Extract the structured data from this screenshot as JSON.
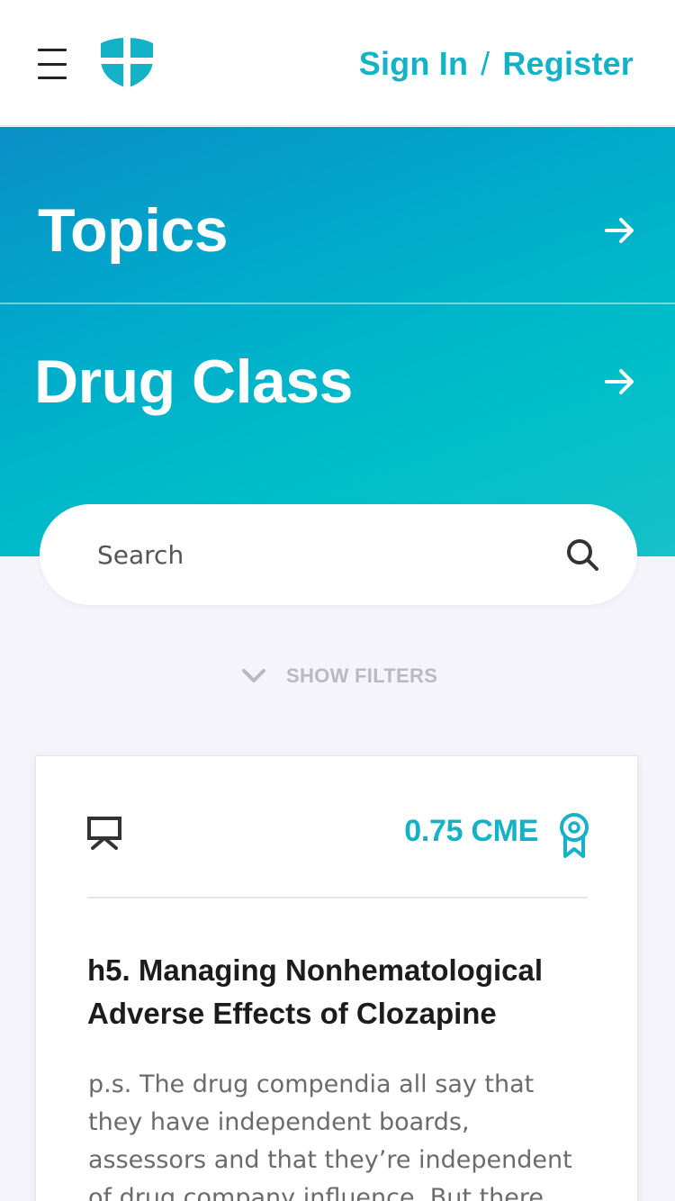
{
  "header": {
    "menu_icon": "hamburger-menu-icon",
    "logo_icon": "shield-cross-icon",
    "sign_in": "Sign In",
    "separator": "/",
    "register": "Register",
    "accent_color": "#13b2c6"
  },
  "hero": {
    "items": [
      {
        "label": "Topics",
        "icon": "arrow-right-icon"
      },
      {
        "label": "Drug Class",
        "icon": "arrow-right-icon"
      }
    ]
  },
  "search": {
    "placeholder": "Search",
    "value": "",
    "icon": "search-icon"
  },
  "filters": {
    "label": "SHOW FILTERS",
    "icon": "chevron-down-icon"
  },
  "card": {
    "type_icon": "presentation-icon",
    "cme": "0.75 CME",
    "cme_icon": "award-ribbon-icon",
    "title": "h5. Managing Nonhematological Adverse Effects of Clozapine",
    "body": "p.s. The drug compendia all say that they have independent boards, assessors and that they’re independent of drug company influence. But there was a"
  }
}
